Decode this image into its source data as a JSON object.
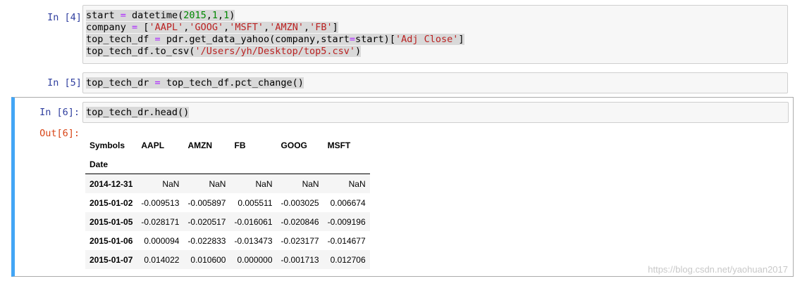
{
  "cells": [
    {
      "prompt": "In [4]:",
      "lines": [
        [
          {
            "t": "start ",
            "c": ""
          },
          {
            "t": "=",
            "c": "op"
          },
          {
            "t": " datetime(",
            "c": ""
          },
          {
            "t": "2015",
            "c": "num"
          },
          {
            "t": ",",
            "c": ""
          },
          {
            "t": "1",
            "c": "num"
          },
          {
            "t": ",",
            "c": ""
          },
          {
            "t": "1",
            "c": "num"
          },
          {
            "t": ")",
            "c": ""
          }
        ],
        [
          {
            "t": "company ",
            "c": ""
          },
          {
            "t": "=",
            "c": "op"
          },
          {
            "t": " [",
            "c": ""
          },
          {
            "t": "'AAPL'",
            "c": "str"
          },
          {
            "t": ",",
            "c": ""
          },
          {
            "t": "'GOOG'",
            "c": "str"
          },
          {
            "t": ",",
            "c": ""
          },
          {
            "t": "'MSFT'",
            "c": "str"
          },
          {
            "t": ",",
            "c": ""
          },
          {
            "t": "'AMZN'",
            "c": "str"
          },
          {
            "t": ",",
            "c": ""
          },
          {
            "t": "'FB'",
            "c": "str"
          },
          {
            "t": "]",
            "c": ""
          }
        ],
        [
          {
            "t": "top_tech_df ",
            "c": ""
          },
          {
            "t": "=",
            "c": "op"
          },
          {
            "t": " pdr.get_data_yahoo(company,start",
            "c": ""
          },
          {
            "t": "=",
            "c": "op"
          },
          {
            "t": "start)[",
            "c": ""
          },
          {
            "t": "'Adj Close'",
            "c": "str"
          },
          {
            "t": "]",
            "c": ""
          }
        ],
        [
          {
            "t": "top_tech_df.to_csv(",
            "c": ""
          },
          {
            "t": "'/Users/yh/Desktop/top5.csv'",
            "c": "str"
          },
          {
            "t": ")",
            "c": ""
          }
        ]
      ]
    },
    {
      "prompt": "In [5]:",
      "lines": [
        [
          {
            "t": "top_tech_dr ",
            "c": ""
          },
          {
            "t": "=",
            "c": "op"
          },
          {
            "t": " top_tech_df.pct_change()",
            "c": ""
          }
        ]
      ]
    },
    {
      "prompt": "In [6]:",
      "lines": [
        [
          {
            "t": "top_tech_dr.head()",
            "c": ""
          }
        ]
      ]
    }
  ],
  "output": {
    "prompt": "Out[6]:",
    "columns_label": "Symbols",
    "index_label": "Date",
    "columns": [
      "AAPL",
      "AMZN",
      "FB",
      "GOOG",
      "MSFT"
    ],
    "rows": [
      {
        "date": "2014-12-31",
        "values": [
          "NaN",
          "NaN",
          "NaN",
          "NaN",
          "NaN"
        ]
      },
      {
        "date": "2015-01-02",
        "values": [
          "-0.009513",
          "-0.005897",
          "0.005511",
          "-0.003025",
          "0.006674"
        ]
      },
      {
        "date": "2015-01-05",
        "values": [
          "-0.028171",
          "-0.020517",
          "-0.016061",
          "-0.020846",
          "-0.009196"
        ]
      },
      {
        "date": "2015-01-06",
        "values": [
          "0.000094",
          "-0.022833",
          "-0.013473",
          "-0.023177",
          "-0.014677"
        ]
      },
      {
        "date": "2015-01-07",
        "values": [
          "0.014022",
          "0.010600",
          "0.000000",
          "-0.001713",
          "0.012706"
        ]
      }
    ]
  },
  "watermark": "https://blog.csdn.net/yaohuan2017"
}
